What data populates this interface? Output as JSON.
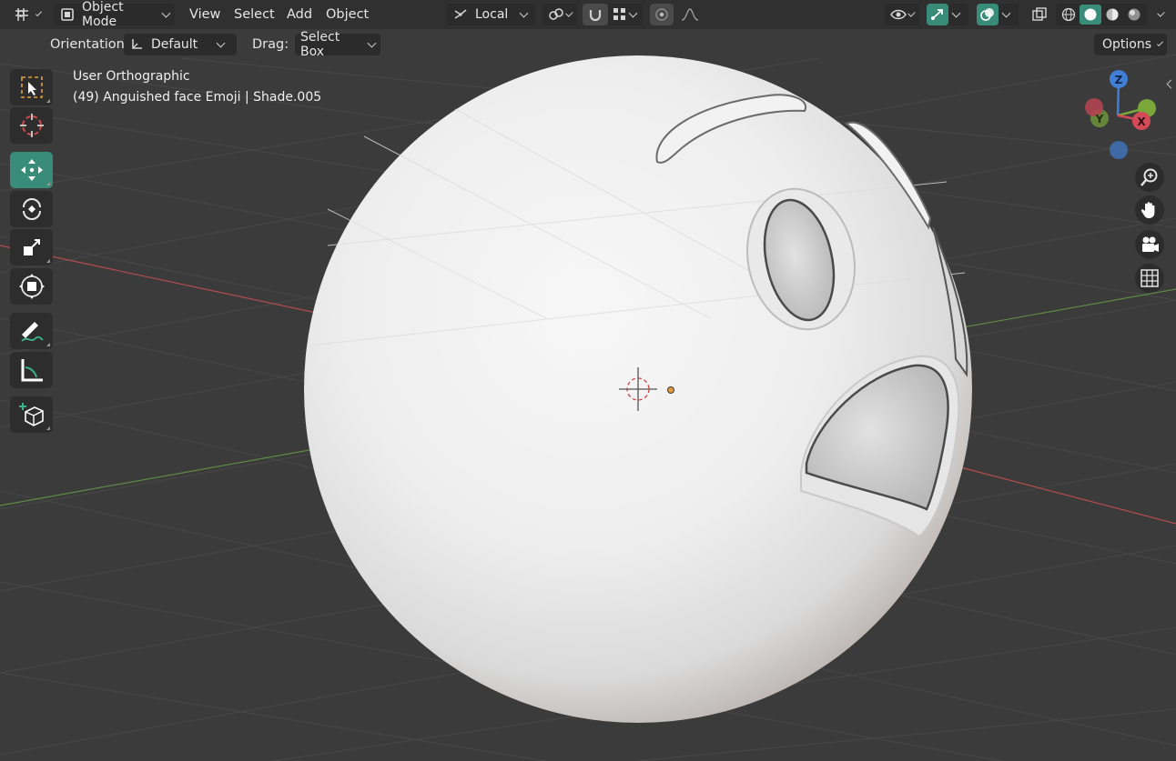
{
  "header": {
    "editor_type_icon": "3d-viewport-icon",
    "mode": "Object Mode",
    "menus": [
      "View",
      "Select",
      "Add",
      "Object"
    ],
    "transform_pivot": "Local",
    "options_label": "Options"
  },
  "tool_settings": {
    "orientation_label": "Orientation:",
    "orientation_value": "Default",
    "drag_label": "Drag:",
    "drag_value": "Select Box"
  },
  "overlay_text": {
    "view_name": "User Orthographic",
    "object_info": "(49) Anguished face Emoji | Shade.005"
  },
  "toolbar": [
    {
      "name": "select-box-tool",
      "icon": "select-box-icon",
      "active": false
    },
    {
      "name": "cursor-tool",
      "icon": "cursor-icon",
      "active": false
    },
    {
      "name": "move-tool",
      "icon": "move-icon",
      "active": true
    },
    {
      "name": "rotate-tool",
      "icon": "rotate-icon",
      "active": false
    },
    {
      "name": "scale-tool",
      "icon": "scale-icon",
      "active": false
    },
    {
      "name": "transform-tool",
      "icon": "transform-icon",
      "active": false
    },
    {
      "name": "annotate-tool",
      "icon": "annotate-icon",
      "active": false
    },
    {
      "name": "measure-tool",
      "icon": "measure-icon",
      "active": false
    },
    {
      "name": "add-cube-tool",
      "icon": "add-cube-icon",
      "active": false
    }
  ],
  "gizmo": {
    "z": "Z",
    "y": "Y",
    "x": "X"
  },
  "colors": {
    "accent": "#3a8c7a",
    "viewport_bg": "#3b3b3b",
    "header_bg": "#303030",
    "axis_x": "#c75a5a",
    "axis_y": "#6a9a4a",
    "gizmo_z": "#3f7fd6",
    "gizmo_y": "#7aa63a",
    "gizmo_x": "#d44b57"
  }
}
